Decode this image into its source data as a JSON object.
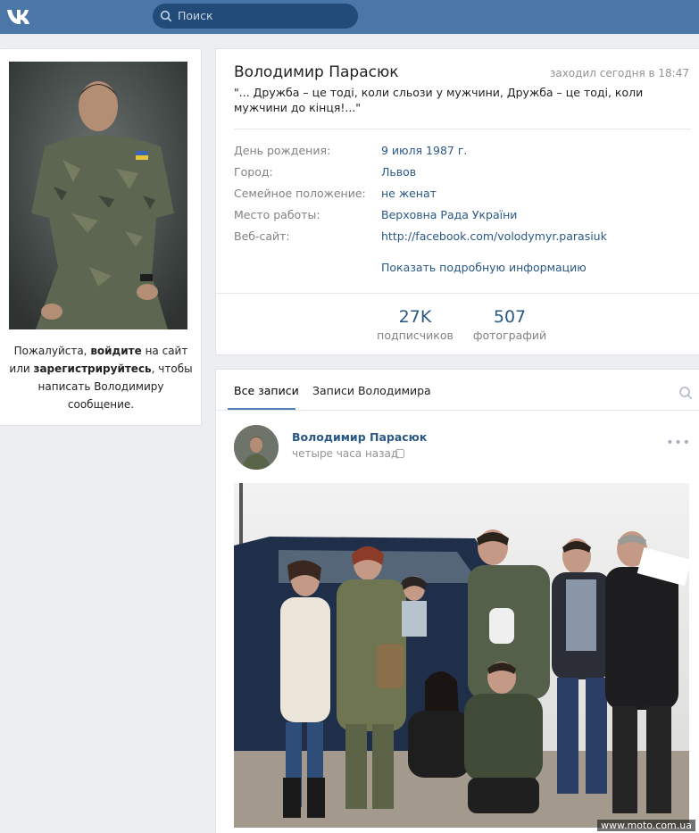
{
  "topbar": {
    "logo_text": "VK",
    "search_placeholder": "Поиск"
  },
  "sidebar": {
    "login_text_1": "Пожалуйста, ",
    "login_link": "войдите",
    "login_text_2": " на сайт или ",
    "register_link": "зарегистрируйтесь",
    "login_text_3": ", чтобы написать Володимиру сообщение."
  },
  "profile": {
    "name": "Володимир Парасюк",
    "last_seen": "заходил сегодня в 18:47",
    "status": "\"... Дружба – це тоді, коли сльози у мужчини, Дружба – це тоді, коли мужчини до кінця!...\"",
    "info": [
      {
        "label": "День рождения:",
        "value": "9 июля 1987 г."
      },
      {
        "label": "Город:",
        "value": "Львов"
      },
      {
        "label": "Семейное положение:",
        "value": "не женат"
      },
      {
        "label": "Место работы:",
        "value": "Верховна Рада України"
      },
      {
        "label": "Веб-сайт:",
        "value": "http://facebook.com/volodymyr.parasiuk"
      }
    ],
    "more_info": "Показать подробную информацию",
    "counters": [
      {
        "num": "27K",
        "label": "подписчиков"
      },
      {
        "num": "507",
        "label": "фотографий"
      }
    ]
  },
  "wall": {
    "tabs": [
      "Все записи",
      "Записи Володимира"
    ],
    "post": {
      "author": "Володимир Парасюк",
      "time": "четыре часа назад",
      "more": "•••"
    }
  },
  "watermark": "www.moto.com.ua",
  "colors": {
    "header": "#4a76a8",
    "link": "#2a5885",
    "background": "#edeef0"
  }
}
